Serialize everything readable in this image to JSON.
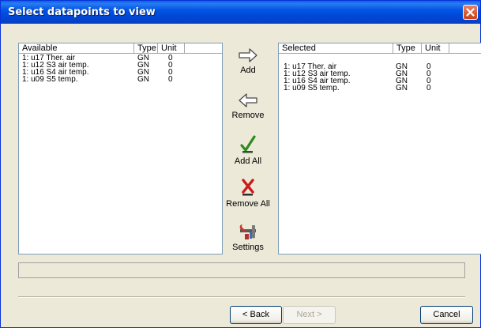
{
  "window": {
    "title": "Select datapoints to view"
  },
  "available": {
    "columns": [
      "Available",
      "Type",
      "Unit"
    ],
    "rows": [
      {
        "name": "1: u17 Ther. air",
        "type": "GN",
        "unit": "0"
      },
      {
        "name": "1: u12 S3 air temp.",
        "type": "GN",
        "unit": "0"
      },
      {
        "name": "1: u16 S4 air temp.",
        "type": "GN",
        "unit": "0"
      },
      {
        "name": "1: u09 S5 temp.",
        "type": "GN",
        "unit": "0"
      }
    ]
  },
  "selected": {
    "columns": [
      "Selected",
      "Type",
      "Unit"
    ],
    "rows": [
      {
        "name": "1: u17 Ther. air",
        "type": "GN",
        "unit": "0"
      },
      {
        "name": "1: u12 S3 air temp.",
        "type": "GN",
        "unit": "0"
      },
      {
        "name": "1: u16 S4 air temp.",
        "type": "GN",
        "unit": "0"
      },
      {
        "name": "1: u09 S5 temp.",
        "type": "GN",
        "unit": "0"
      }
    ]
  },
  "actions": {
    "add": {
      "label": "Add",
      "icon": "arrow-right-icon"
    },
    "remove": {
      "label": "Remove",
      "icon": "arrow-left-icon"
    },
    "add_all": {
      "label": "Add All",
      "icon": "checkmark-icon"
    },
    "remove_all": {
      "label": "Remove All",
      "icon": "red-x-icon"
    },
    "settings": {
      "label": "Settings",
      "icon": "tools-icon"
    }
  },
  "footer": {
    "back_label": "< Back",
    "next_label": "Next >",
    "cancel_label": "Cancel"
  },
  "colors": {
    "titlebar": "#0055e5",
    "dialog_bg": "#ece9d8",
    "close_button": "#d65a32"
  }
}
